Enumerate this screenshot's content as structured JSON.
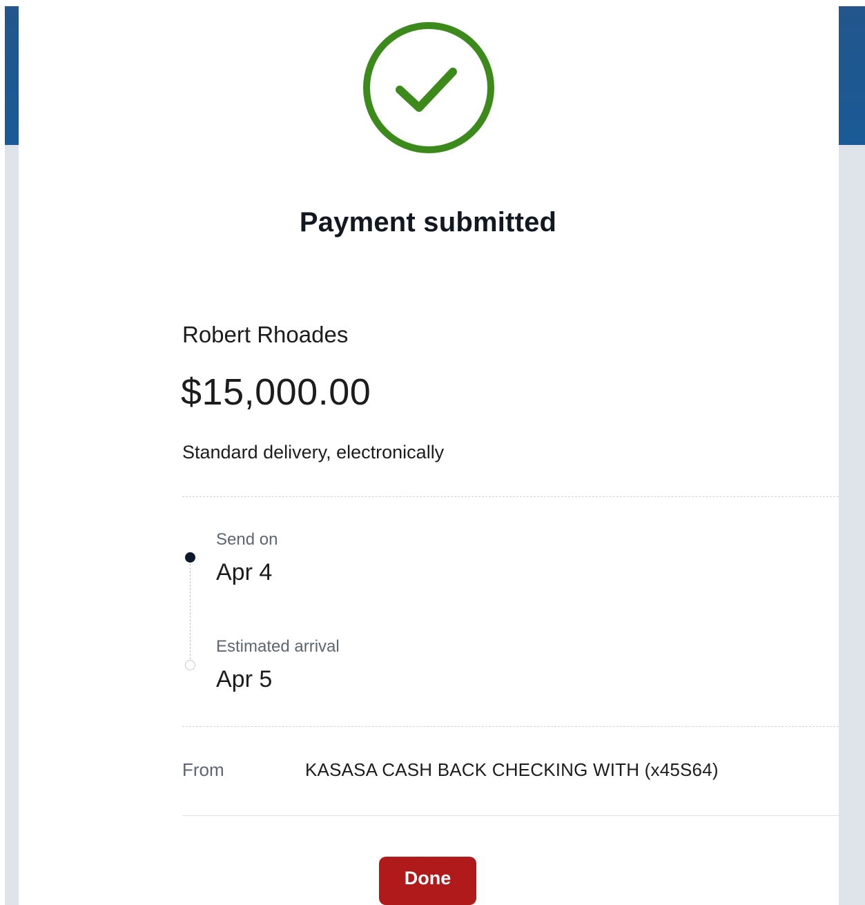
{
  "confirmation": {
    "title": "Payment submitted",
    "status_icon": "check-circle-icon",
    "success_color": "#3d8a1c"
  },
  "payment": {
    "payee": "Robert Rhoades",
    "amount": "$15,000.00",
    "delivery_method": "Standard delivery, electronically"
  },
  "timeline": {
    "send": {
      "label": "Send on",
      "date": "Apr 4"
    },
    "arrival": {
      "label": "Estimated arrival",
      "date": "Apr 5"
    }
  },
  "source_account": {
    "label": "From",
    "value": "KASASA CASH BACK CHECKING WITH (x45S64)"
  },
  "actions": {
    "done_label": "Done",
    "done_color": "#b01a1a"
  },
  "theme": {
    "header_blue": "#1e5a93",
    "backdrop": "#dfe3ea"
  }
}
